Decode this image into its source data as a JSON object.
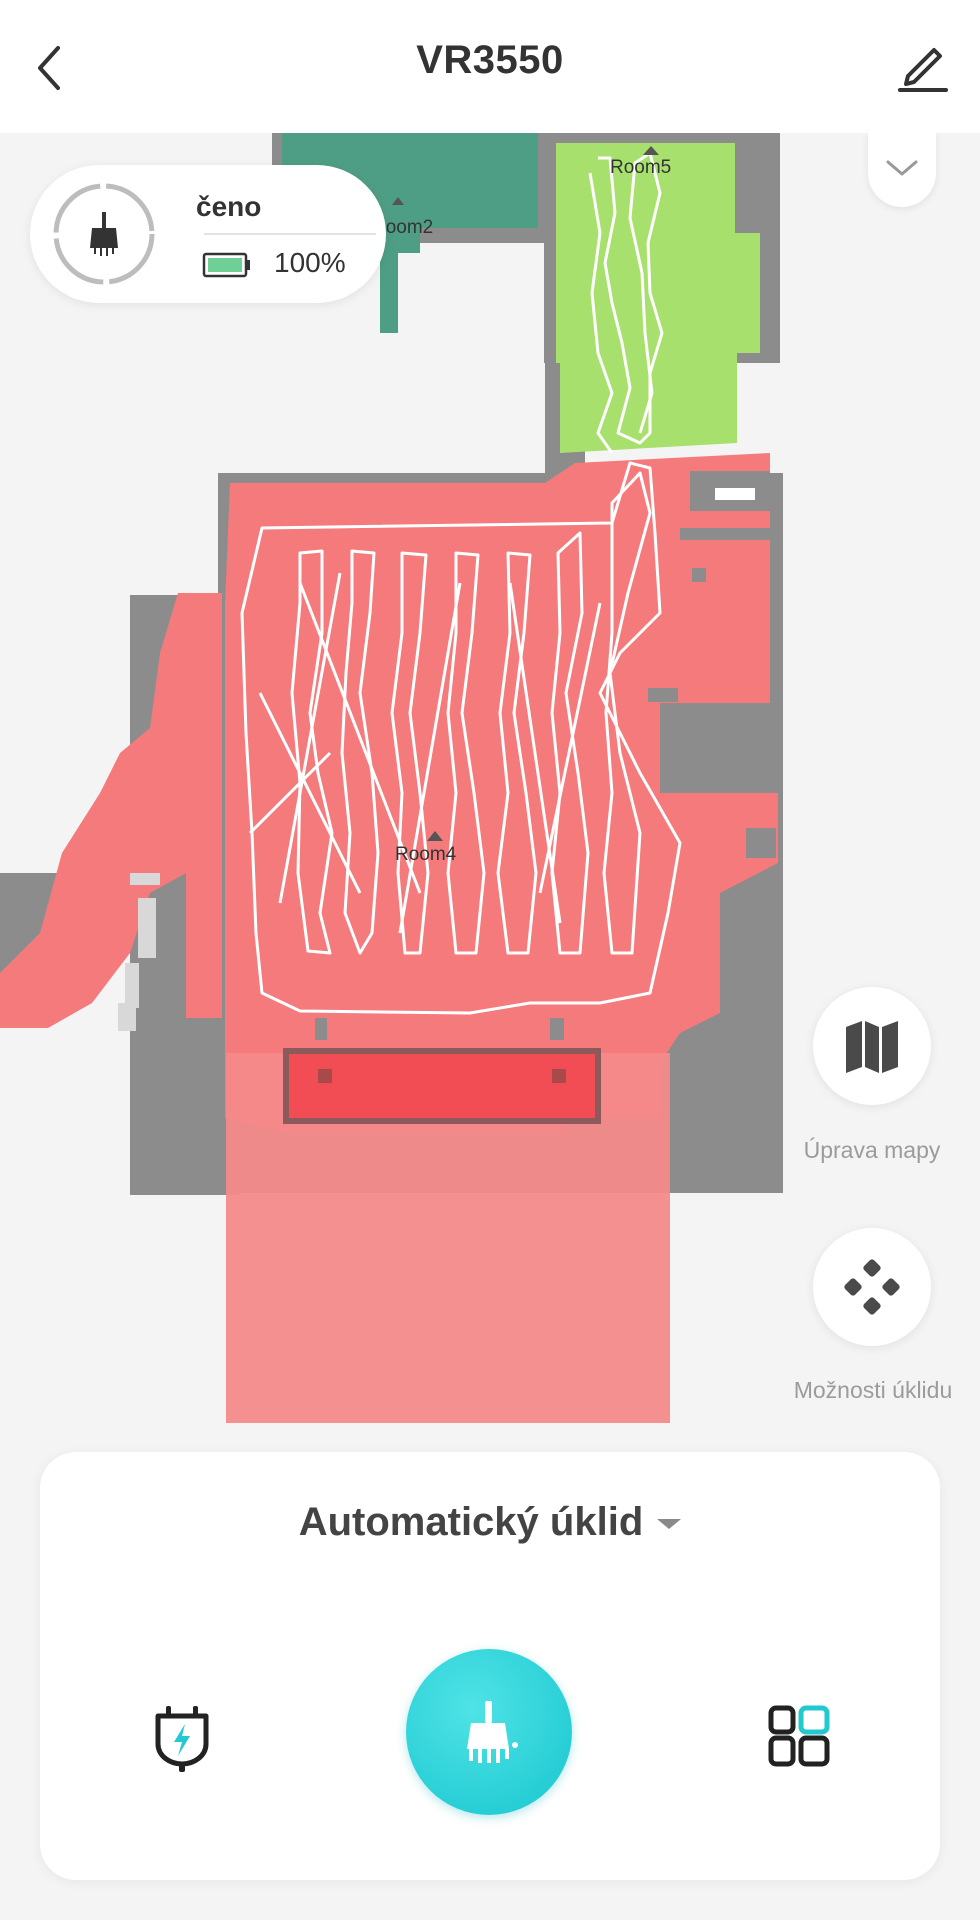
{
  "header": {
    "title": "VR3550",
    "back_icon": "chevron-left-icon",
    "edit_icon": "pencil-icon"
  },
  "status": {
    "state_text": "čeno",
    "battery_percent": "100%",
    "battery_level": 1.0,
    "icon": "broom-icon"
  },
  "map": {
    "rooms": [
      "Room2",
      "Room5",
      "Room4"
    ],
    "colors": {
      "room2": "#4e9e85",
      "room5": "#a8e06e",
      "room4": "#f47a7c",
      "wall": "#8c8c8c",
      "zone": "#f48a8a",
      "zone_dark": "#f24c55",
      "path": "#ffffff"
    }
  },
  "side_actions": [
    {
      "label": "Úprava mapy",
      "icon": "map-icon"
    },
    {
      "label": "Možnosti úklidu",
      "icon": "diamond-grid-icon"
    }
  ],
  "panel": {
    "mode_label": "Automatický úklid",
    "dock_icon": "dock-charge-icon",
    "clean_icon": "broom-icon",
    "rooms_icon": "room-select-icon",
    "accent": "#22c9d1"
  }
}
